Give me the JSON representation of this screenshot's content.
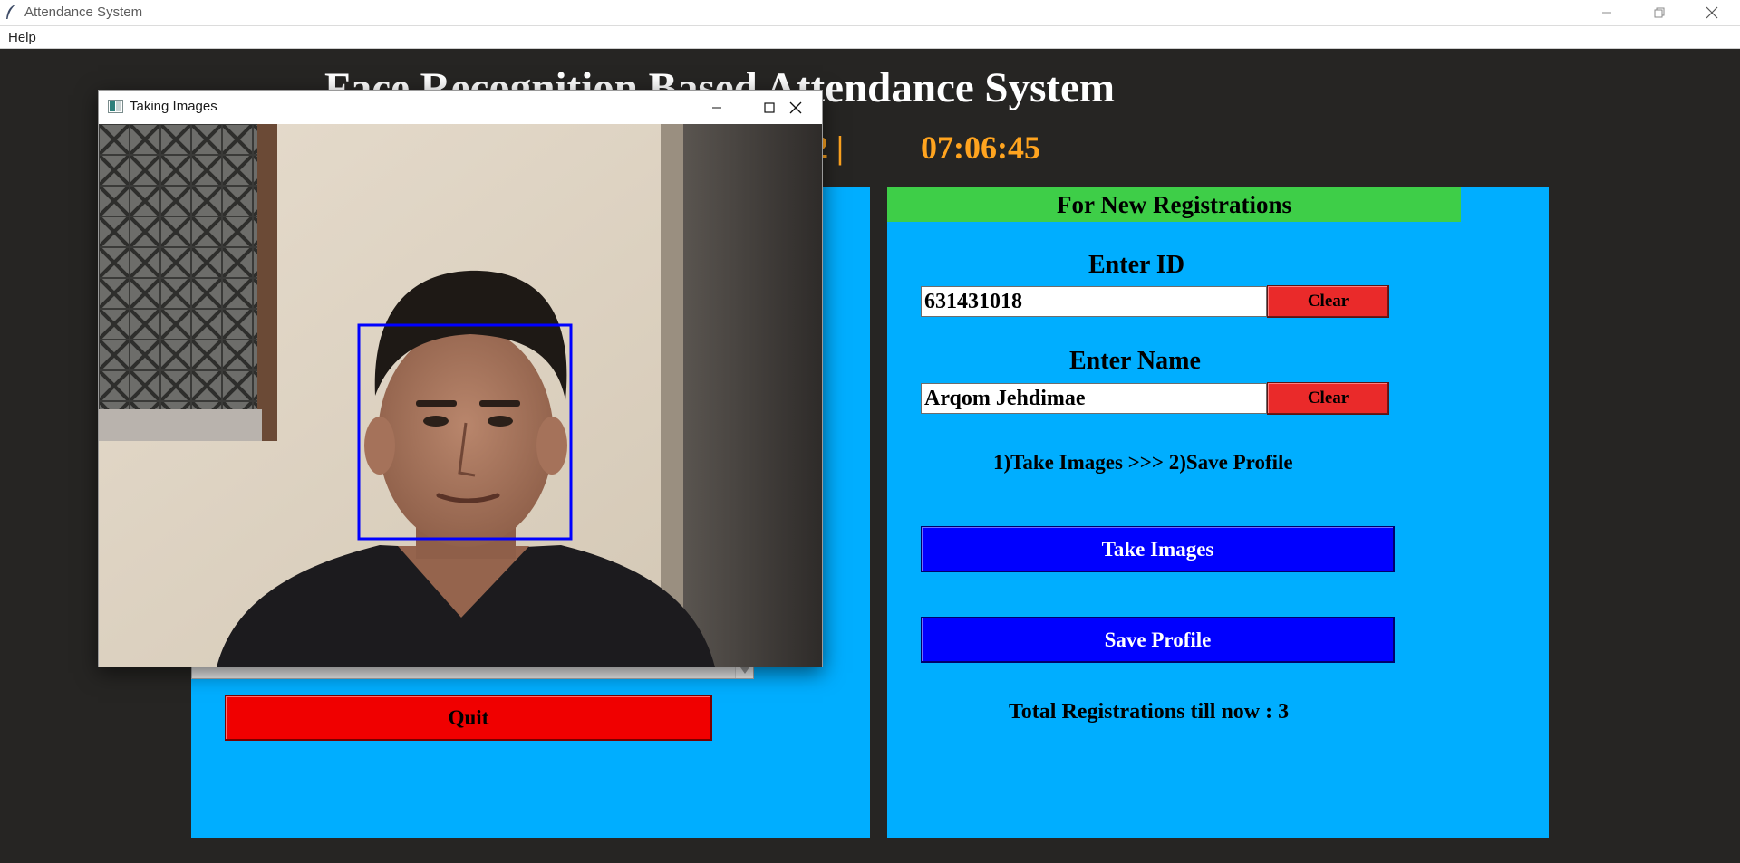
{
  "window": {
    "title": "Attendance System",
    "menu": {
      "help_label": "Help"
    }
  },
  "app": {
    "title": "Face Recognition Based Attendance System",
    "date_partial": "22  |",
    "time": "07:06:45",
    "registration": {
      "header": "For New Registrations",
      "id_label": "Enter ID",
      "id_value": "631431018",
      "name_label": "Enter Name",
      "name_value": "Arqom Jehdimae",
      "clear_label": "Clear",
      "steps_text": "1)Take Images  >>>  2)Save Profile",
      "take_images_label": "Take Images",
      "save_profile_label": "Save Profile",
      "total_text": "Total Registrations till now  : 3"
    },
    "attendance": {
      "quit_label": "Quit"
    }
  },
  "camera_window": {
    "title": "Taking Images"
  },
  "colors": {
    "background": "#262523",
    "panel": "#00aeff",
    "header_green": "#3ece48",
    "clear_red": "#ea2a2a",
    "quit_red": "#f00000",
    "action_blue": "#0000ff",
    "clock_orange": "#ffa41f",
    "face_box": "#0000ff"
  },
  "icons": {
    "app": "feather-icon",
    "camera_window": "opencv-window-icon",
    "minimize": "minimize-icon",
    "maximize": "maximize-icon",
    "restore": "restore-icon",
    "close": "close-icon",
    "scroll": "chevron-down-icon"
  }
}
